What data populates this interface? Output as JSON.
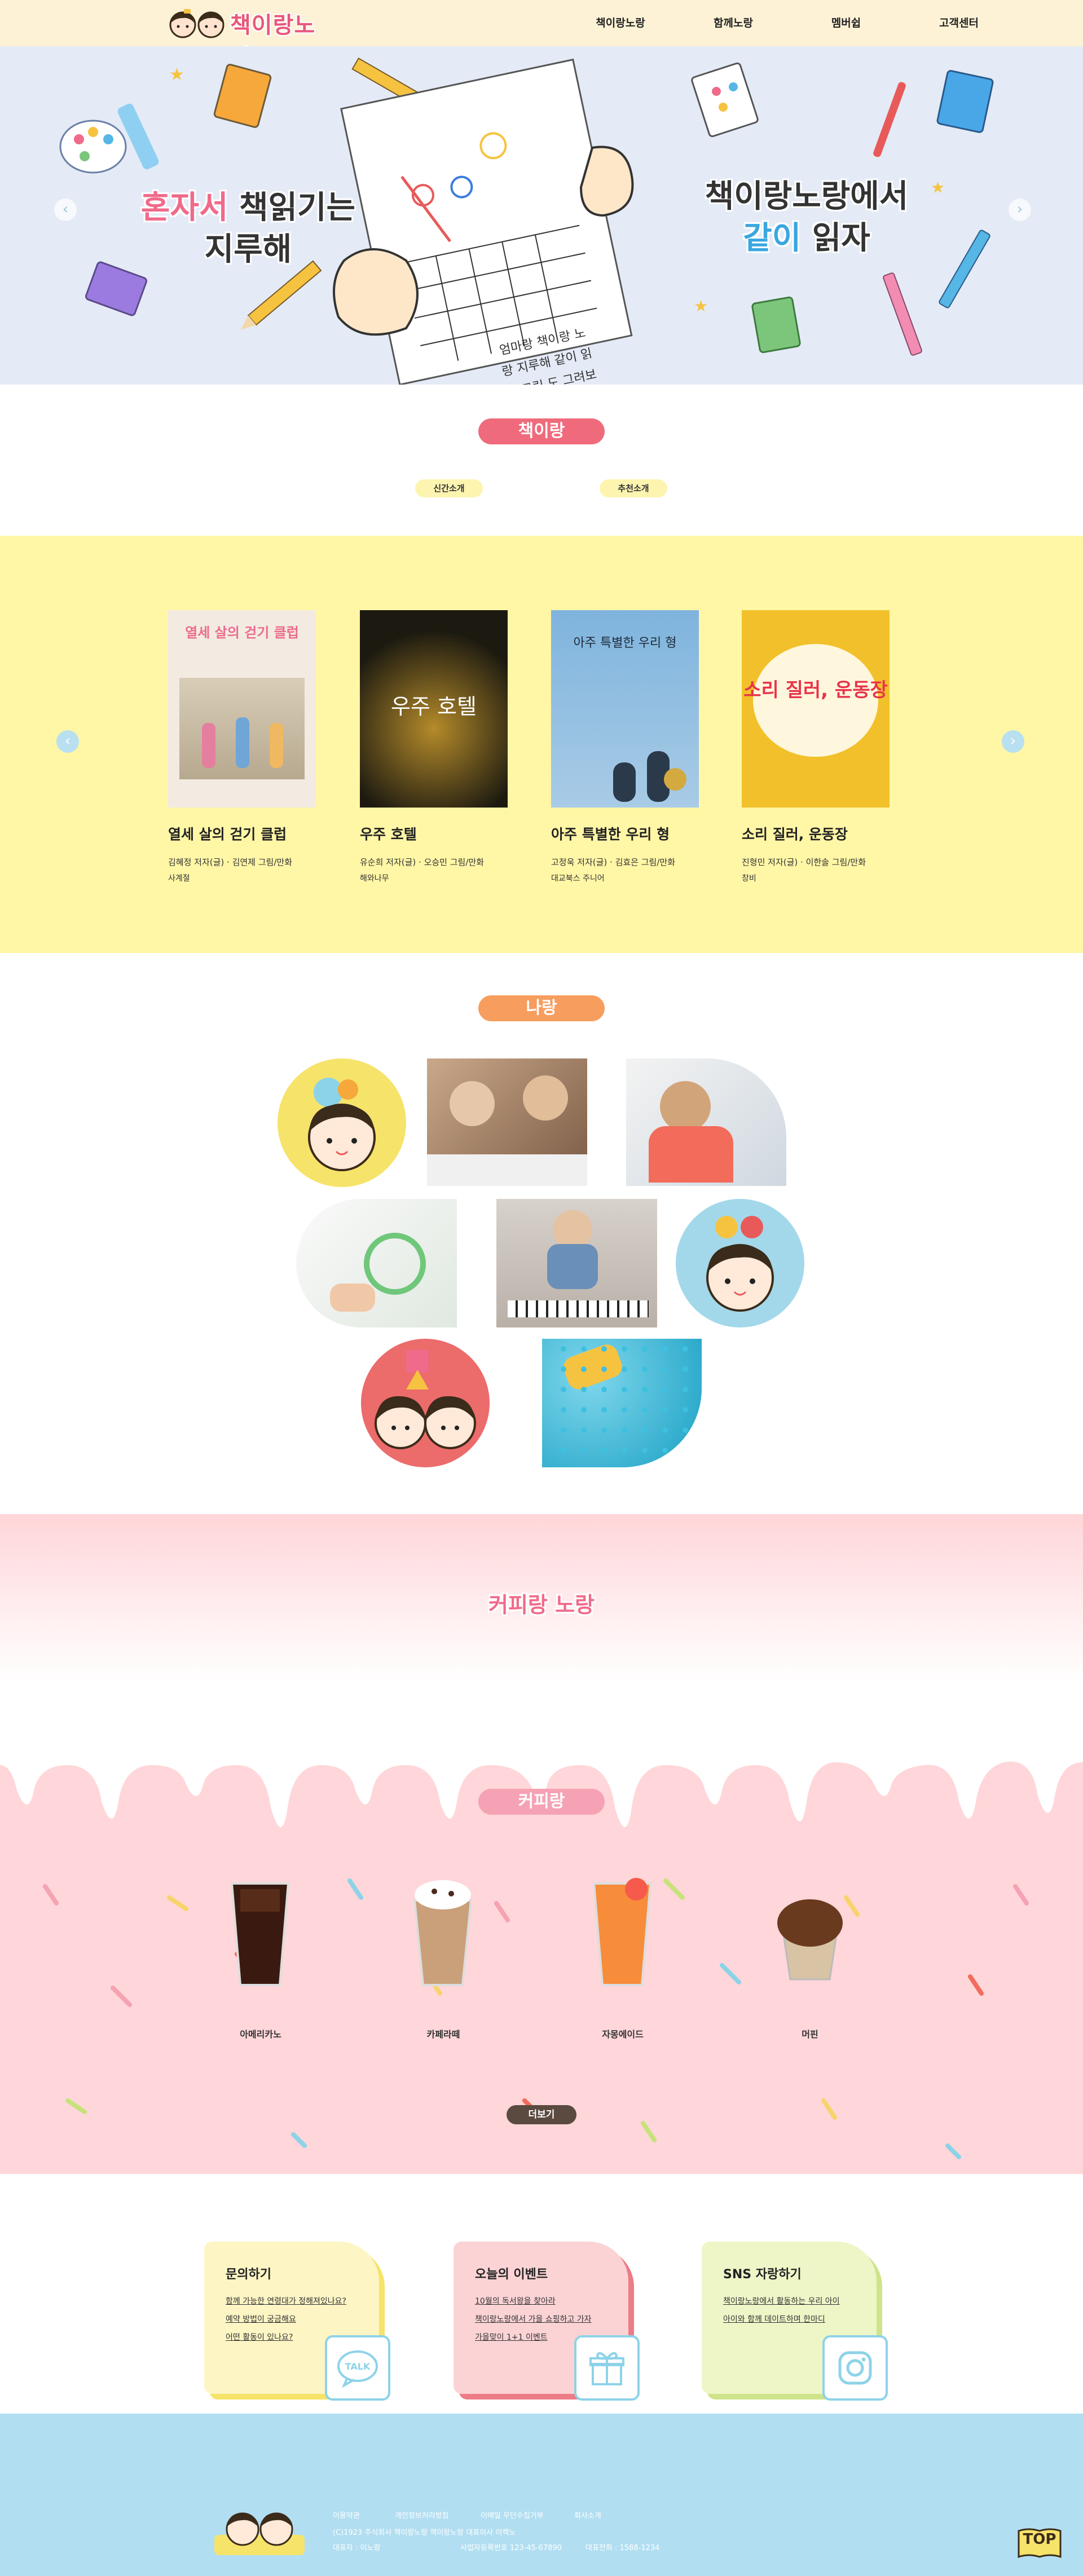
{
  "header": {
    "logo_text": "책이랑노랑",
    "nav": [
      "책이랑노랑",
      "함께노랑",
      "멤버쉽",
      "고객센터"
    ]
  },
  "hero": {
    "left_line1_a": "혼자서",
    "left_line1_b": " 책읽기는",
    "left_line2": "지루해",
    "right_line1": "책이랑노랑에서",
    "right_line2_a": "같이",
    "right_line2_b": " 읽자",
    "paper_row1": "엄마랑 책이랑 노",
    "paper_row2": "랑 지루해 같이 읽",
    "paper_row3": "자 그림 도 그려보"
  },
  "book_section": {
    "title": "책이랑",
    "tabs": [
      "신간소개",
      "추천소개"
    ],
    "books": [
      {
        "title": "열세 살의 걷기 클럽",
        "authors": "김혜정 저자(글) · 김연제 그림/만화",
        "publisher": "사계절",
        "cover_text": "열세 살의 걷기 클럽",
        "cover_color": "#f3ebe2"
      },
      {
        "title": "우주 호텔",
        "authors": "유순희 저자(글) · 오승민 그림/만화",
        "publisher": "해와나무",
        "cover_text": "우주 호텔",
        "cover_color": "#1c1a10"
      },
      {
        "title": "아주 특별한 우리 형",
        "authors": "고정욱 저자(글) · 김효은 그림/만화",
        "publisher": "대교북스 주니어",
        "cover_text": "아주 특별한 우리 형",
        "cover_color": "#7fb4dd"
      },
      {
        "title": "소리 질러, 운동장",
        "authors": "진형민 저자(글) · 이한솔 그림/만화",
        "publisher": "창비",
        "cover_text": "소리 질러, 운동장",
        "cover_color": "#f2c02a"
      }
    ]
  },
  "play_section": {
    "title": "나랑"
  },
  "cafe_section": {
    "banner_title": "커피랑 노랑",
    "title": "커피랑",
    "drinks": [
      "아메리카노",
      "카페라떼",
      "자몽에이드",
      "머핀"
    ],
    "more_label": "더보기"
  },
  "cards": [
    {
      "title": "문의하기",
      "links": [
        "함께 가능한 연령대가 정해져있나요?",
        "예약 방법이 궁금해요",
        "어떤 활동이 있나요?"
      ],
      "icon_label": "TALK",
      "bg": "#fdf5c4",
      "shadow": "#f6e36a"
    },
    {
      "title": "오늘의 이벤트",
      "links": [
        "10월의 독서왕을 찾아라",
        "책이랑노랑에서 가을 쇼핑하고 가자",
        "가을맞이 1+1 이벤트"
      ],
      "bg": "#fbd3d5",
      "shadow": "#ec7c85"
    },
    {
      "title": "SNS 자랑하기",
      "links": [
        "책이랑노랑에서 활동하는 우리 아이",
        "아이와 함께 데이트하며 한마디"
      ],
      "bg": "#eef6c8",
      "shadow": "#cfe38b"
    }
  ],
  "footer": {
    "links": [
      "이용약관",
      "개인정보처리방침",
      "이메일 무단수집거부",
      "회사소개"
    ],
    "address": "(C)1923 주식회사 책이랑노랑 책이랑노랑 대표이사 이책노",
    "tel": "대표전화 : 1588-1234",
    "biz": "사업자등록번호 123-45-67890",
    "owner": "대표자 : 이노랑",
    "top_label": "TOP"
  }
}
